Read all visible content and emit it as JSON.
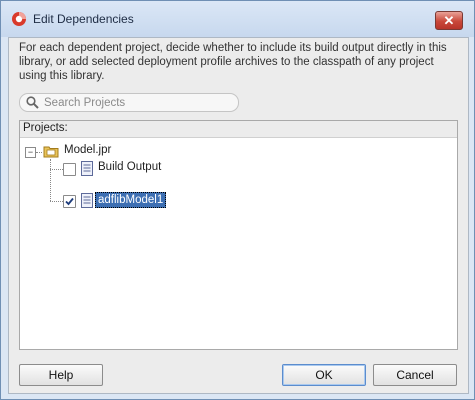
{
  "window": {
    "title": "Edit Dependencies",
    "close_glyph": "✕"
  },
  "description": "For each dependent project, decide whether to include its build output directly in this library, or add selected deployment profile archives to the classpath of any project using this library.",
  "search": {
    "placeholder": "Search Projects",
    "value": ""
  },
  "projects_panel": {
    "header": "Projects:",
    "root": {
      "label": "Model.jpr",
      "expanded": true,
      "expander_glyph": "−"
    },
    "items": [
      {
        "label": "Build Output",
        "checked": false,
        "selected": false
      },
      {
        "label": "adflibModel1",
        "checked": true,
        "selected": true
      }
    ]
  },
  "buttons": {
    "help": "Help",
    "ok": "OK",
    "cancel": "Cancel"
  },
  "colors": {
    "accent": "#3d6fb3",
    "close": "#c9483a"
  }
}
